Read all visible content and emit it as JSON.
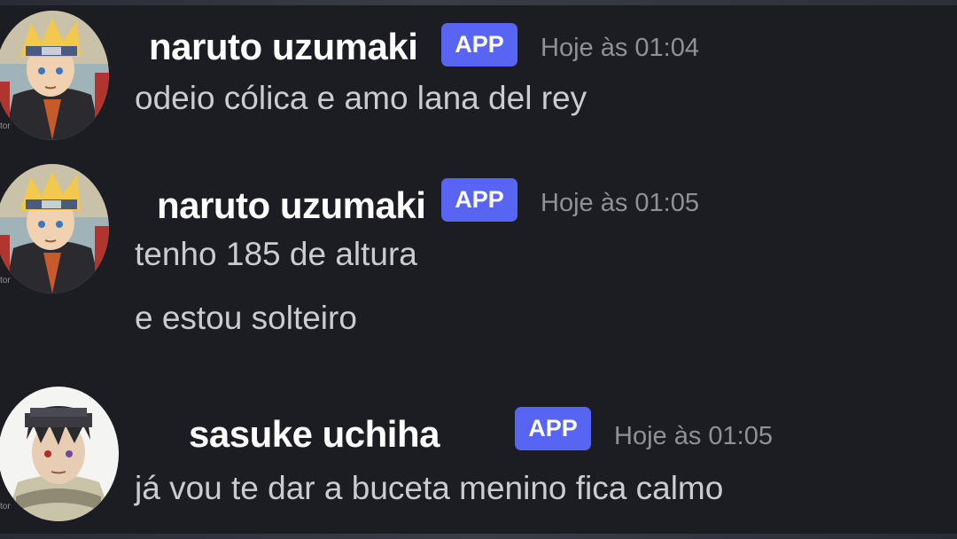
{
  "messages": [
    {
      "username": "naruto uzumaki",
      "badge": "APP",
      "timestamp": "Hoje às 01:04",
      "lines": [
        "odeio cólica e amo lana del rey"
      ],
      "avatar_caption": "tor"
    },
    {
      "username": "naruto uzumaki",
      "badge": "APP",
      "timestamp": "Hoje às 01:05",
      "lines": [
        "tenho 185 de altura",
        "e estou solteiro"
      ],
      "avatar_caption": "tor"
    },
    {
      "username": "sasuke uchiha",
      "badge": "APP",
      "timestamp": "Hoje às 01:05",
      "lines": [
        "já vou te dar a buceta menino fica calmo"
      ],
      "avatar_caption": "tor"
    }
  ],
  "colors": {
    "background": "#1c1d22",
    "badge": "#5865f2",
    "username": "#ffffff",
    "timestamp": "#8e9297",
    "message_text": "#c9ccd1"
  },
  "icons": {
    "avatar_1": "naruto-avatar",
    "avatar_2": "naruto-avatar",
    "avatar_3": "sasuke-avatar"
  }
}
